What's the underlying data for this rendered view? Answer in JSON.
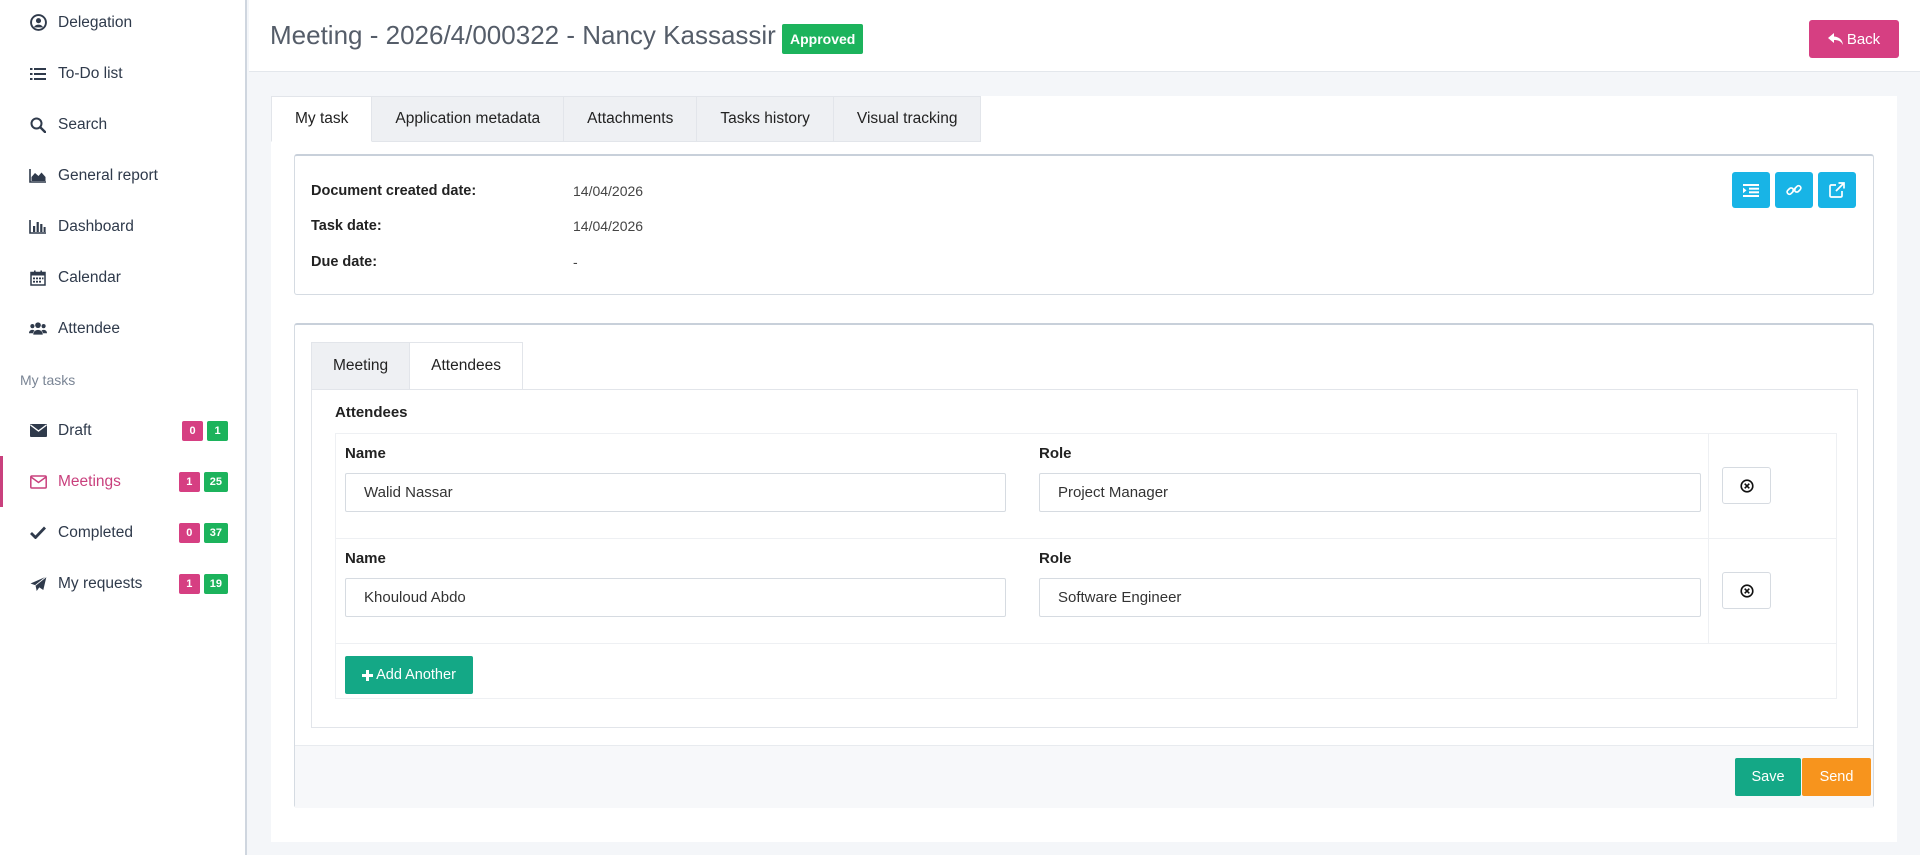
{
  "sidebar": {
    "items": [
      {
        "label": "Delegation",
        "icon": "user-circle-icon"
      },
      {
        "label": "To-Do list",
        "icon": "list-icon"
      },
      {
        "label": "Search",
        "icon": "search-icon"
      },
      {
        "label": "General report",
        "icon": "area-chart-icon"
      },
      {
        "label": "Dashboard",
        "icon": "bar-chart-icon"
      },
      {
        "label": "Calendar",
        "icon": "calendar-icon"
      },
      {
        "label": "Attendee",
        "icon": "users-icon"
      }
    ],
    "section_title": "My tasks",
    "tasks": [
      {
        "label": "Draft",
        "icon": "envelope-icon",
        "count_pink": "0",
        "count_green": "1",
        "active": false
      },
      {
        "label": "Meetings",
        "icon": "envelope-open-icon",
        "count_pink": "1",
        "count_green": "25",
        "active": true
      },
      {
        "label": "Completed",
        "icon": "check-icon",
        "count_pink": "0",
        "count_green": "37",
        "active": false
      },
      {
        "label": "My requests",
        "icon": "paper-plane-icon",
        "count_pink": "1",
        "count_green": "19",
        "active": false
      }
    ]
  },
  "header": {
    "title": "Meeting - 2026/4/000322 - Nancy Kassassir",
    "status": "Approved",
    "back_label": "Back"
  },
  "tabs": [
    "My task",
    "Application metadata",
    "Attachments",
    "Tasks history",
    "Visual tracking"
  ],
  "info": {
    "created_label": "Document created date:",
    "created_value": "14/04/2026",
    "task_label": "Task date:",
    "task_value": "14/04/2026",
    "due_label": "Due date:",
    "due_value": "-"
  },
  "inner_tabs": [
    "Meeting",
    "Attendees"
  ],
  "attendees": {
    "title": "Attendees",
    "name_label": "Name",
    "role_label": "Role",
    "rows": [
      {
        "name": "Walid Nassar",
        "role": "Project Manager"
      },
      {
        "name": "Khouloud Abdo",
        "role": "Software Engineer"
      }
    ],
    "add_label": "Add Another"
  },
  "footer": {
    "save_label": "Save",
    "send_label": "Send"
  },
  "colors": {
    "accent": "#d63f82",
    "success": "#1cb35c",
    "teal": "#14a886",
    "info": "#18b4e6",
    "warning": "#f7941d"
  }
}
